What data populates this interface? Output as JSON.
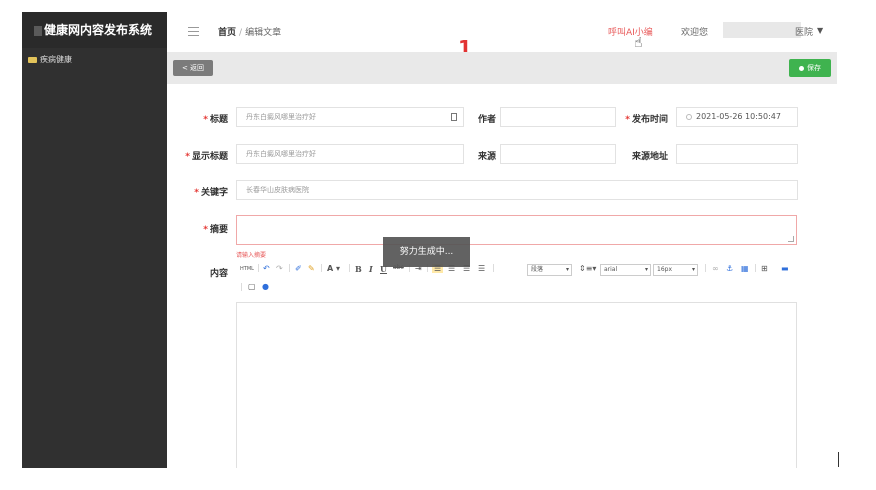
{
  "app": {
    "title": "健康网内容发布系统"
  },
  "sidebar": {
    "items": [
      {
        "label": "疾病健康"
      }
    ]
  },
  "topbar": {
    "breadcrumb": {
      "home": "首页",
      "separator": "/",
      "current": "编辑文章"
    },
    "ai_link": "呼叫AI小编",
    "welcome": "欢迎您",
    "user_suffix": "医院",
    "annotation": "1"
  },
  "toolbar": {
    "back_label": "< 返回",
    "save_label": "保存"
  },
  "form": {
    "title": {
      "label": "标题",
      "value": "丹东白癜风哪里治疗好"
    },
    "author": {
      "label": "作者",
      "value": ""
    },
    "publish_time": {
      "label": "发布时间",
      "value": "2021-05-26 10:50:47"
    },
    "display_title": {
      "label": "显示标题",
      "value": "丹东白癜风哪里治疗好"
    },
    "source": {
      "label": "来源",
      "value": ""
    },
    "source_url": {
      "label": "来源地址",
      "value": ""
    },
    "keywords": {
      "label": "关键字",
      "value": "长春华山皮肤病医院"
    },
    "summary": {
      "label": "摘要",
      "value": "",
      "warning": "请输入摘要"
    },
    "content": {
      "label": "内容"
    }
  },
  "toast": {
    "text": "努力生成中..."
  },
  "editor": {
    "paragraph_select": "段落",
    "font_select": "arial",
    "size_select": "16px",
    "icons": [
      "html-icon",
      "undo-icon",
      "redo-icon",
      "eraser-icon",
      "brush-icon",
      "font-color-icon",
      "bold-icon",
      "italic-icon",
      "underline-icon",
      "strikethrough-icon",
      "indent-icon",
      "align-left-icon",
      "align-center-icon",
      "align-right-icon",
      "justify-icon",
      "line-height-icon",
      "link-icon",
      "anchor-icon",
      "image-icon",
      "table-icon",
      "preview-icon",
      "file-icon",
      "help-icon"
    ]
  },
  "colors": {
    "accent_red": "#e53935",
    "save_green": "#3fb34f",
    "sidebar_bg": "#303030"
  }
}
